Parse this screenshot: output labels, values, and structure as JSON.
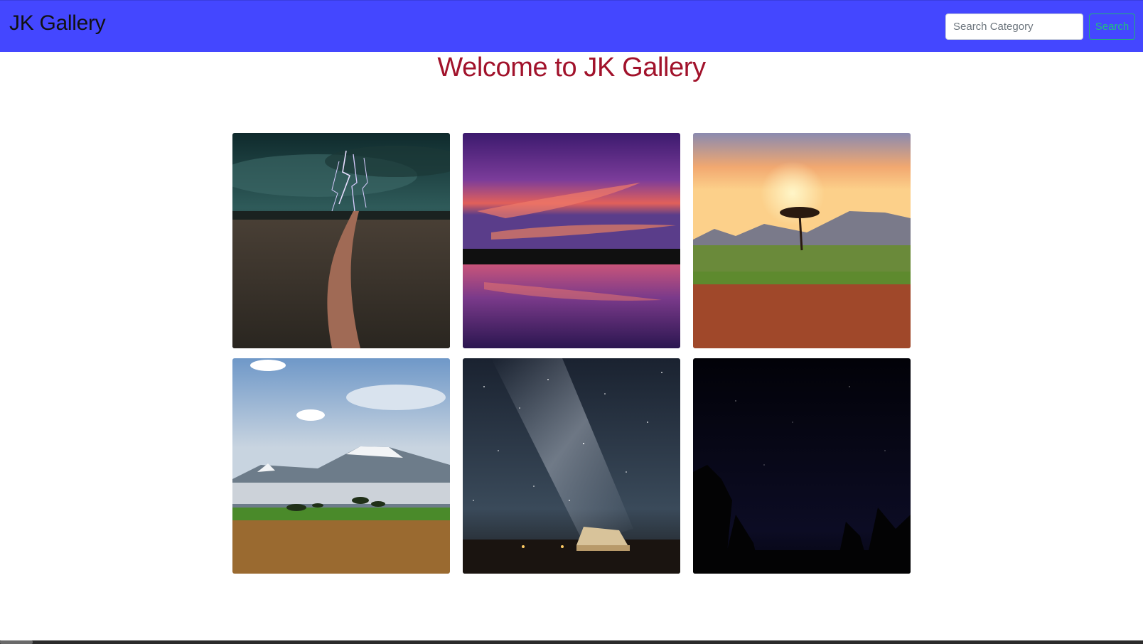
{
  "navbar": {
    "brand": "JK Gallery",
    "search_placeholder": "Search Category",
    "search_button": "Search",
    "color": "#4447ff"
  },
  "main": {
    "title": "Welcome to JK Gallery",
    "title_color": "#a1122b"
  },
  "gallery": {
    "images": [
      {
        "icon": "lightning-field-photo"
      },
      {
        "icon": "sunset-lake-photo"
      },
      {
        "icon": "savanna-tree-sunset-photo"
      },
      {
        "icon": "kilimanjaro-plains-photo"
      },
      {
        "icon": "milky-way-tent-photo"
      },
      {
        "icon": "night-sky-trees-photo"
      }
    ]
  }
}
